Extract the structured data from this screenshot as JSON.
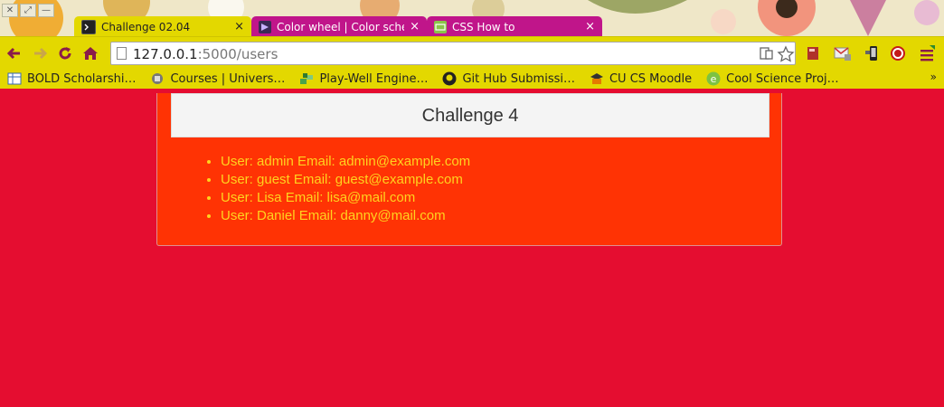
{
  "browser": {
    "window_controls": [
      "✕",
      "⤢",
      "—"
    ],
    "tabs": [
      {
        "title": "Challenge 02.04",
        "close": "×",
        "active": true,
        "icon": "terminal-icon"
      },
      {
        "title": "Color wheel | Color schem",
        "close": "×",
        "active": false,
        "icon": "color-wheel-icon"
      },
      {
        "title": "CSS How to",
        "close": "×",
        "active": false,
        "icon": "css-icon"
      }
    ],
    "address": {
      "host": "127.0.0.1",
      "path": ":5000/users"
    },
    "bookmarks": [
      {
        "label": "BOLD Scholarshi…",
        "icon": "table-icon"
      },
      {
        "label": "Courses | Univers…",
        "icon": "courses-icon"
      },
      {
        "label": "Play-Well Engine…",
        "icon": "blocks-icon"
      },
      {
        "label": "Git Hub Submissi…",
        "icon": "github-icon"
      },
      {
        "label": "CU CS Moodle",
        "icon": "moodle-icon"
      },
      {
        "label": "Cool Science Proj…",
        "icon": "evernote-icon"
      }
    ],
    "bookmarks_more": "»",
    "colors": {
      "tab_active": "#e3d800",
      "tab_inactive": "#c0158a",
      "toolbar": "#e3d800"
    }
  },
  "page": {
    "heading": "Challenge 4",
    "users": [
      "User: admin Email: admin@example.com",
      "User: guest Email: guest@example.com",
      "User: Lisa Email: lisa@mail.com",
      "User: Daniel Email: danny@mail.com"
    ],
    "colors": {
      "background": "#e50d30",
      "card": "#ff3304",
      "text": "#ffd31f"
    }
  }
}
